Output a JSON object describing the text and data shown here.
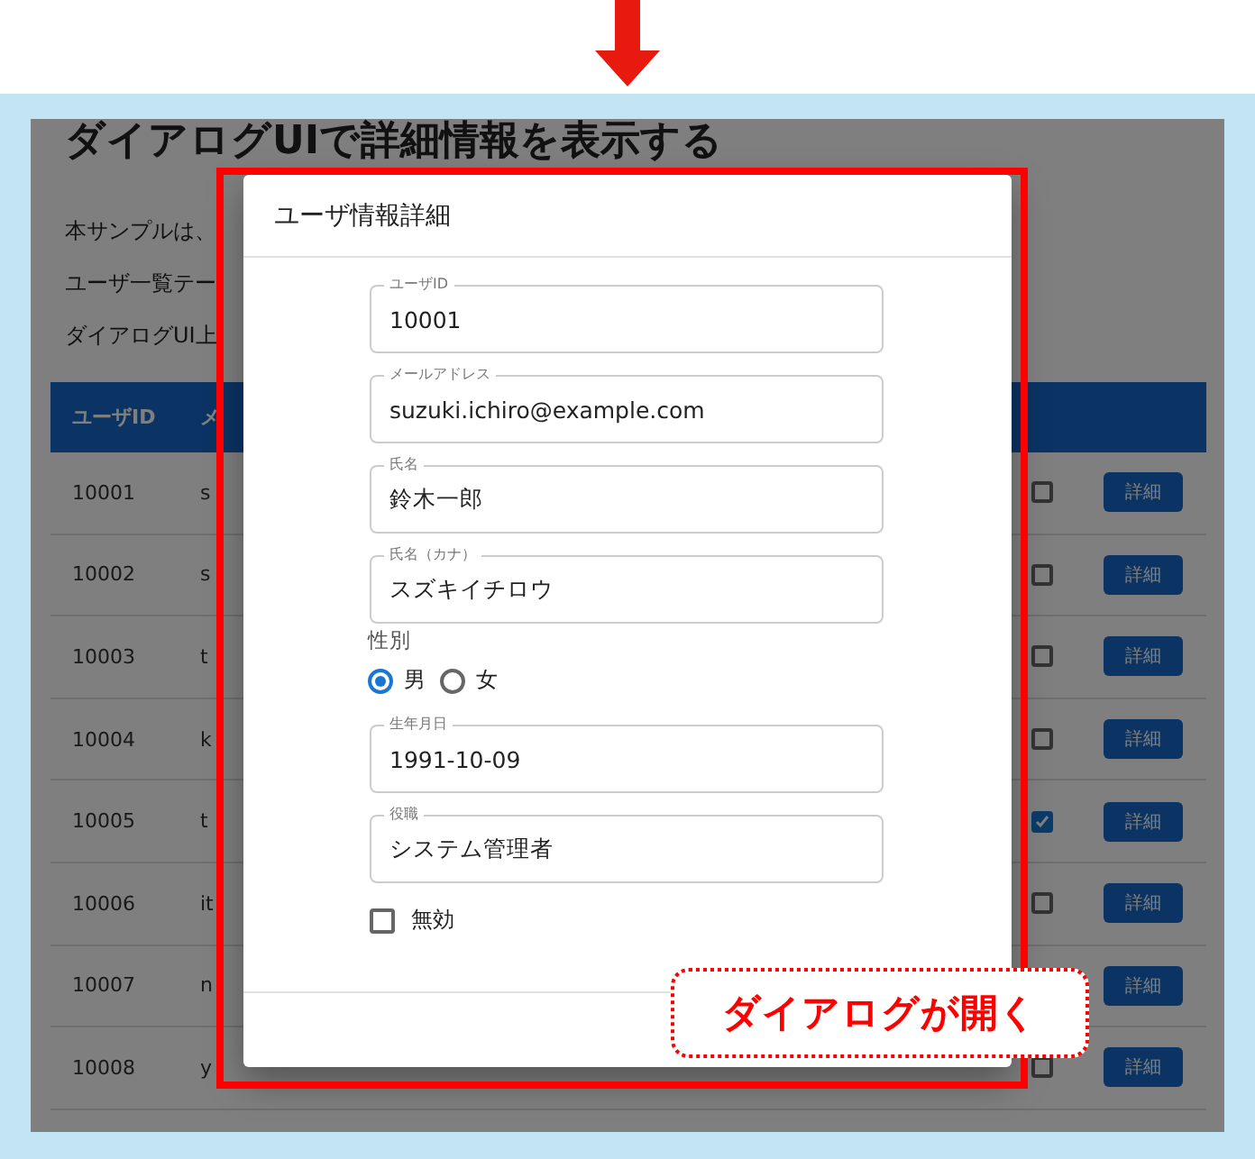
{
  "page": {
    "title": "ダイアログUIで詳細情報を表示する",
    "paragraphs": [
      "本サンプルは、",
      "ユーザ一覧テー",
      "ダイアログUI上"
    ]
  },
  "table": {
    "columns": [
      "ユーザID",
      "メ"
    ],
    "rows": [
      {
        "id": "10001",
        "email": "s",
        "checked": false,
        "action": "詳細"
      },
      {
        "id": "10002",
        "email": "s",
        "checked": false,
        "action": "詳細"
      },
      {
        "id": "10003",
        "email": "t",
        "checked": false,
        "action": "詳細"
      },
      {
        "id": "10004",
        "email": "k",
        "checked": false,
        "action": "詳細"
      },
      {
        "id": "10005",
        "email": "t",
        "checked": true,
        "action": "詳細"
      },
      {
        "id": "10006",
        "email": "it",
        "checked": false,
        "action": "詳細"
      },
      {
        "id": "10007",
        "email": "n",
        "action": "詳細"
      },
      {
        "id": "10008",
        "email": "y",
        "checked": false,
        "action": "詳細"
      }
    ]
  },
  "dialog": {
    "title": "ユーザ情報詳細",
    "items": [
      {
        "kind": "text",
        "label": "ユーザID",
        "value": "10001"
      },
      {
        "kind": "text",
        "label": "メールアドレス",
        "value": "suzuki.ichiro@example.com"
      },
      {
        "kind": "text",
        "label": "氏名",
        "value": "鈴木一郎"
      },
      {
        "kind": "text",
        "label": "氏名（カナ）",
        "value": "スズキイチロウ"
      },
      {
        "kind": "radio",
        "label": "性別",
        "options": [
          {
            "label": "男",
            "selected": true
          },
          {
            "label": "女",
            "selected": false
          }
        ]
      },
      {
        "kind": "text",
        "label": "生年月日",
        "value": "1991-10-09"
      },
      {
        "kind": "text",
        "label": "役職",
        "value": "システム管理者"
      },
      {
        "kind": "checkbox",
        "label": "無効",
        "checked": false
      }
    ]
  },
  "callout": "ダイアログが開く"
}
